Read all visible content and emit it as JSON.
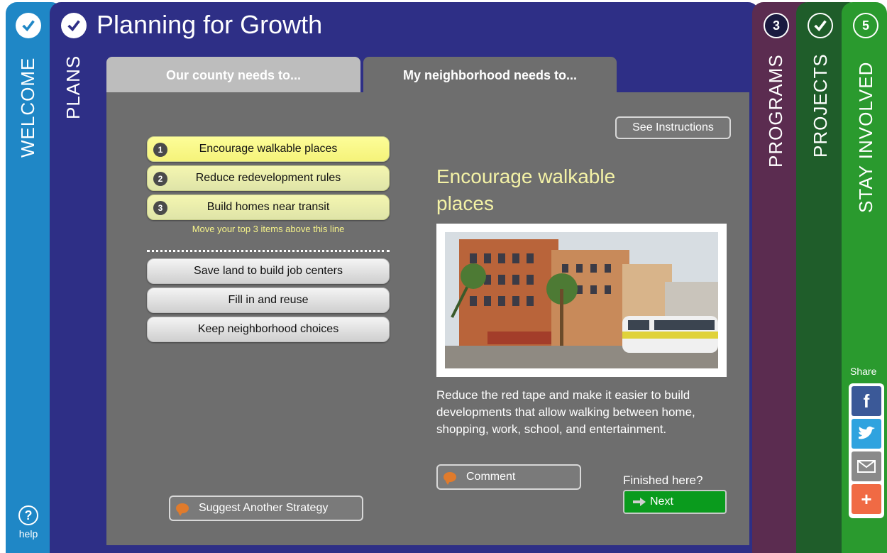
{
  "app": {
    "title": "Planning for Growth"
  },
  "side_panels": {
    "welcome": {
      "label": "WELCOME",
      "status": "checked"
    },
    "plans": {
      "label": "PLANS",
      "status": "checked"
    },
    "programs": {
      "label": "PROGRAMS",
      "number": "3"
    },
    "projects": {
      "label": "PROJECTS",
      "status": "checked"
    },
    "stay_involved": {
      "label": "STAY INVOLVED",
      "number": "5"
    }
  },
  "tabs": [
    {
      "label": "Our county needs to...",
      "active": false
    },
    {
      "label": "My neighborhood needs to...",
      "active": true
    }
  ],
  "instructions_button": "See Instructions",
  "ranked_items": [
    {
      "rank": "1",
      "label": "Encourage walkable places",
      "selected": true
    },
    {
      "rank": "2",
      "label": "Reduce redevelopment rules",
      "selected": false
    },
    {
      "rank": "3",
      "label": "Build homes near transit",
      "selected": false
    }
  ],
  "hint": "Move your top 3 items above this line",
  "other_items": [
    {
      "label": "Save land to build job centers"
    },
    {
      "label": "Fill in and reuse"
    },
    {
      "label": "Keep neighborhood choices"
    }
  ],
  "suggest_button": "Suggest Another Strategy",
  "detail": {
    "title": "Encourage walkable places",
    "description": "Reduce the red tape and make it easier to build developments that allow walking between home, shopping, work, school, and entertainment.",
    "comment_button": "Comment"
  },
  "finished_label": "Finished here?",
  "next_button": "Next",
  "help_label": "help",
  "share": {
    "label": "Share",
    "buttons": [
      {
        "icon": "facebook-icon",
        "color": "#3b5998",
        "glyph": "f"
      },
      {
        "icon": "twitter-icon",
        "color": "#2fa3df",
        "glyph": "t"
      },
      {
        "icon": "email-icon",
        "color": "#8a8a8a",
        "glyph": ""
      },
      {
        "icon": "plus-icon",
        "color": "#f06a44",
        "glyph": "+"
      }
    ]
  },
  "colors": {
    "welcome": "#1f87c6",
    "plans": "#2e2f86",
    "programs": "#5b2c50",
    "projects": "#1f5d2a",
    "stay_involved": "#2a9a2e",
    "highlight": "#f4f2a6",
    "next": "#0a9b1d"
  }
}
